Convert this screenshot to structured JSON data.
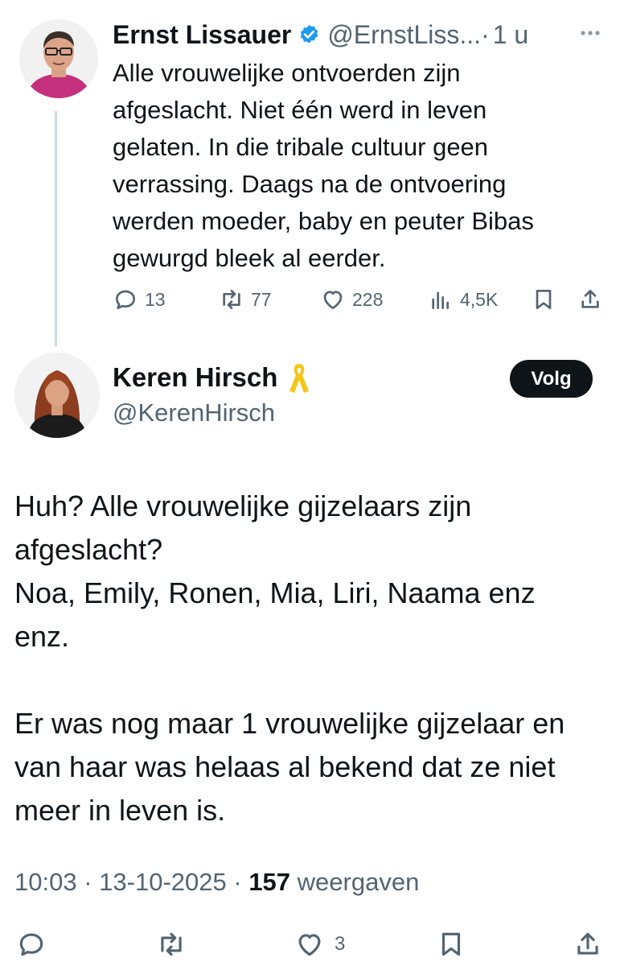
{
  "parent_tweet": {
    "author_name": "Ernst Lissauer",
    "handle": "@ErnstLiss...",
    "separator": "·",
    "time": "1 u",
    "text": "Alle vrouwelijke ontvoerden zijn\nafgeslacht. Niet één werd in leven\ngelaten. In die tribale cultuur geen\nverrassing. Daags na de ontvoering\nwerden moeder, baby en peuter Bibas\ngewurgd bleek al eerder.",
    "actions": {
      "replies": "13",
      "reposts": "77",
      "likes": "228",
      "views": "4,5K"
    },
    "icons": [
      "verified-badge-icon",
      "more-options-icon",
      "reply-icon",
      "repost-icon",
      "like-icon",
      "views-icon",
      "bookmark-icon",
      "share-icon"
    ]
  },
  "main_tweet": {
    "author_name": "Keren Hirsch",
    "handle": "@KerenHirsch",
    "follow_label": "Volg",
    "text": "Huh? Alle vrouwelijke gijzelaars zijn\nafgeslacht?\nNoa, Emily, Ronen, Mia, Liri, Naama enz\nenz.\n\nEr was nog maar 1 vrouwelijke gijzelaar en\nvan haar was helaas al bekend dat ze niet\nmeer in leven is.",
    "time": "10:03",
    "date": "13-10-2025",
    "meta_separator": "·",
    "views_count": "157",
    "views_label": "weergaven",
    "actions": {
      "likes": "3"
    },
    "icons": [
      "yellow-ribbon-icon",
      "reply-icon",
      "repost-icon",
      "like-icon",
      "bookmark-icon",
      "share-icon"
    ]
  },
  "colors": {
    "text_primary": "#0f1419",
    "text_secondary": "#536471",
    "verified_blue": "#1d9bf0",
    "ribbon_yellow": "#f5c518",
    "thread_line": "#cfd9de",
    "follow_button_bg": "#0f1419"
  }
}
